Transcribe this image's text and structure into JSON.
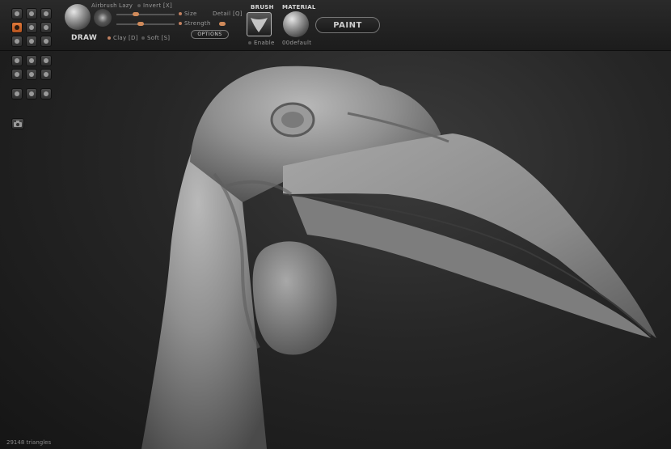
{
  "toolbar": {
    "tool_name": "DRAW",
    "airbrush_label": "Airbrush",
    "lazy_label": "Lazy",
    "invert_label": "Invert [X]",
    "size_label": "Size",
    "strength_label": "Strength",
    "detail_label": "Detail [Q]",
    "clay_label": "Clay [D]",
    "soft_label": "Soft [S]",
    "options_label": "OPTIONS",
    "brush_header": "BRUSH",
    "brush_enable": "Enable",
    "material_header": "MATERIAL",
    "material_name": "00default",
    "paint_label": "PAINT"
  },
  "tools": [
    {
      "icon": "sculpt-tool-icon",
      "active": false
    },
    {
      "icon": "rotate-tool-icon",
      "active": false
    },
    {
      "icon": "crop-tool-icon",
      "active": false
    },
    {
      "icon": "draw-brush-icon",
      "active": true
    },
    {
      "icon": "smooth-brush-icon",
      "active": false
    },
    {
      "icon": "move-tool-icon",
      "active": false
    },
    {
      "icon": "inflate-brush-icon",
      "active": false
    },
    {
      "icon": "pinch-brush-icon",
      "active": false
    },
    {
      "icon": "flatten-brush-icon",
      "active": false
    },
    {
      "icon": "symmetry-icon",
      "active": false
    },
    {
      "icon": "wireframe-icon",
      "active": false
    },
    {
      "icon": "grid-icon",
      "active": false
    },
    {
      "icon": "stroke-icon",
      "active": false
    },
    {
      "icon": "mask-icon",
      "active": false
    },
    {
      "icon": "mirror-icon",
      "active": false
    },
    {
      "icon": "light-icon",
      "active": false
    },
    {
      "icon": "settings-icon",
      "active": false
    },
    {
      "icon": "share-icon",
      "active": false
    }
  ],
  "camera_icon": "camera-icon",
  "status": {
    "triangles": "29148 triangles"
  }
}
